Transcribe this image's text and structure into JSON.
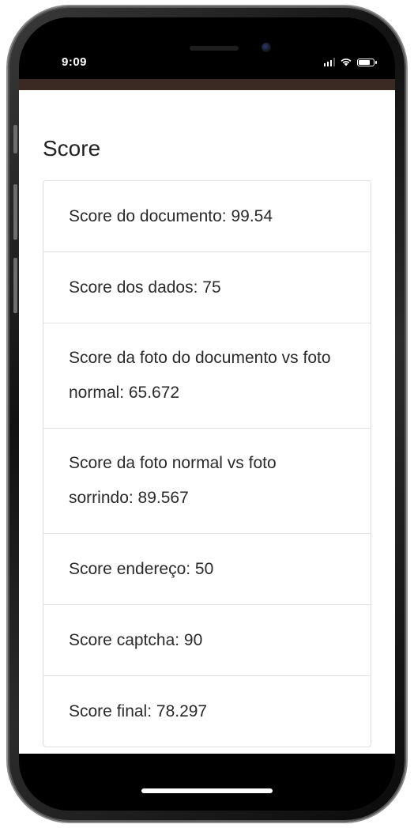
{
  "status_bar": {
    "time": "9:09",
    "battery_level": 0.85,
    "signal_bars": 3
  },
  "main": {
    "section_title": "Score",
    "items": [
      {
        "label": "Score do documento: 99.54"
      },
      {
        "label": "Score dos dados: 75"
      },
      {
        "label": "Score da foto do documento vs foto normal: 65.672"
      },
      {
        "label": "Score da foto normal vs foto sorrindo: 89.567"
      },
      {
        "label": "Score endereço: 50"
      },
      {
        "label": "Score captcha: 90"
      },
      {
        "label": "Score final: 78.297"
      }
    ]
  },
  "colors": {
    "header_strip": "#3b2a24",
    "text": "#2a2a2a",
    "border": "#e2e2e2"
  },
  "icons": [
    "signal-icon",
    "wifi-icon",
    "battery-icon"
  ]
}
